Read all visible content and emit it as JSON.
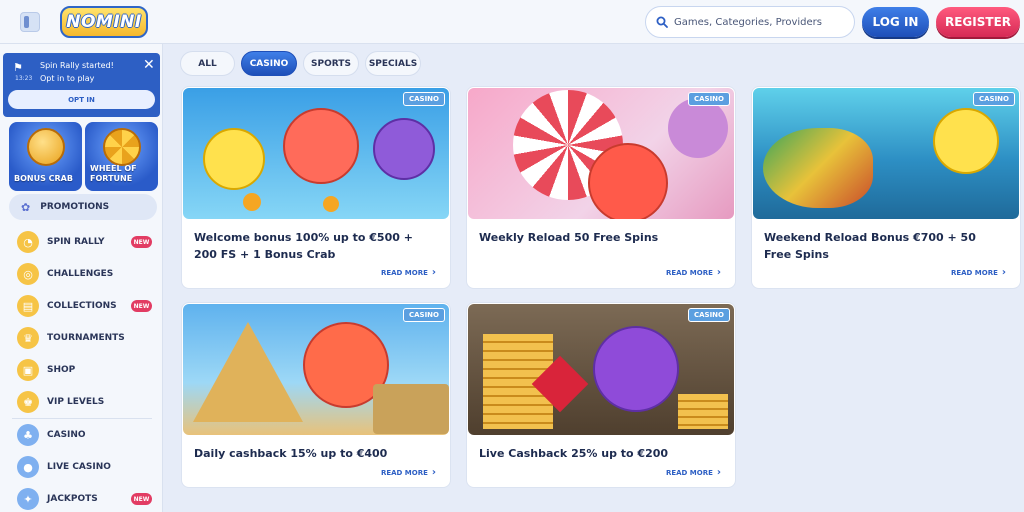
{
  "header": {
    "logo_text": "NOMINI",
    "search_placeholder": "Games, Categories, Providers",
    "login_label": "LOG IN",
    "register_label": "REGISTER"
  },
  "notice": {
    "title": "Spin Rally started!",
    "time": "13:23",
    "subtitle": "Opt in to play",
    "button": "OPT IN"
  },
  "sidebar": {
    "tiles": [
      {
        "label": "BONUS CRAB"
      },
      {
        "label": "WHEEL OF FORTUNE"
      }
    ],
    "promotions_label": "PROMOTIONS",
    "items": [
      {
        "label": "SPIN RALLY",
        "badge": "NEW",
        "icon": "speedometer-icon"
      },
      {
        "label": "CHALLENGES",
        "badge": "",
        "icon": "target-icon"
      },
      {
        "label": "COLLECTIONS",
        "badge": "NEW",
        "icon": "cards-icon"
      },
      {
        "label": "TOURNAMENTS",
        "badge": "",
        "icon": "trophy-icon"
      },
      {
        "label": "SHOP",
        "badge": "",
        "icon": "shop-icon"
      },
      {
        "label": "VIP LEVELS",
        "badge": "",
        "icon": "crown-icon"
      },
      {
        "label": "CASINO",
        "badge": "",
        "icon": "slot-icon"
      },
      {
        "label": "LIVE CASINO",
        "badge": "",
        "icon": "live-icon"
      },
      {
        "label": "JACKPOTS",
        "badge": "NEW",
        "icon": "jackpot-icon"
      }
    ]
  },
  "filters": [
    "ALL",
    "CASINO",
    "SPORTS",
    "SPECIALS"
  ],
  "active_filter": "CASINO",
  "cards": [
    {
      "tag": "CASINO",
      "title": "Welcome bonus 100% up to €500 + 200 FS + 1 Bonus Crab",
      "more": "READ MORE"
    },
    {
      "tag": "CASINO",
      "title": "Weekly Reload 50 Free Spins",
      "more": "READ MORE"
    },
    {
      "tag": "CASINO",
      "title": "Weekend Reload Bonus €700 + 50 Free Spins",
      "more": "READ MORE"
    },
    {
      "tag": "CASINO",
      "title": "Daily cashback 15% up to €400",
      "more": "READ MORE"
    },
    {
      "tag": "CASINO",
      "title": "Live Cashback 25% up to €200",
      "more": "READ MORE"
    }
  ],
  "colors": {
    "primary_blue": "#2d5fc4",
    "register_red": "#d62a55",
    "badge_red": "#e23c63",
    "tag_blue": "#5b9fe0",
    "page_bg": "#e6ecf8"
  }
}
